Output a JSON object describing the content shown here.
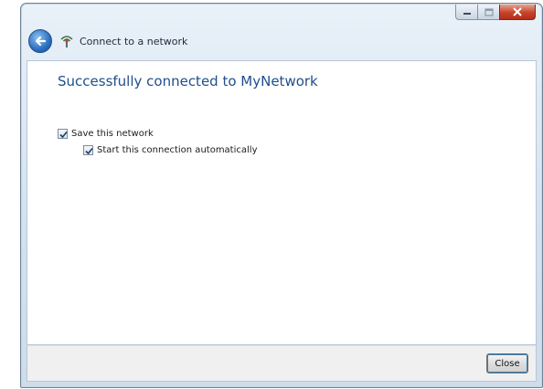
{
  "window": {
    "nav_title": "Connect to a network",
    "caption_buttons": [
      "minimize-icon",
      "maximize-icon",
      "close-icon"
    ]
  },
  "content": {
    "heading": "Successfully connected to MyNetwork",
    "save_network": {
      "label": "Save this network",
      "checked": true
    },
    "start_automatically": {
      "label": "Start this connection automatically",
      "checked": true
    }
  },
  "footer": {
    "close_label": "Close"
  },
  "colors": {
    "heading": "#1f4f8b",
    "close_caption": "#c7432b",
    "back_button": "#2a6fc0"
  }
}
